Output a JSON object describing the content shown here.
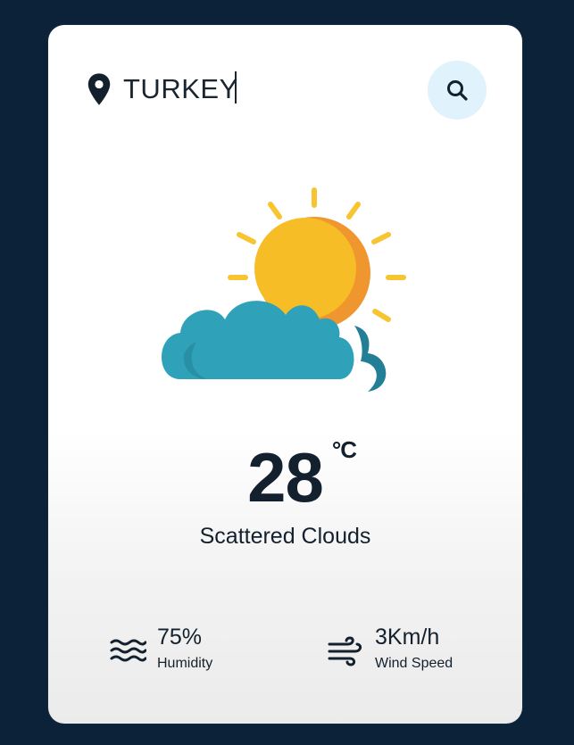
{
  "search": {
    "value": "TURKEY",
    "placeholder": "",
    "icon": "map-pin-icon",
    "button_icon": "search-icon"
  },
  "weather": {
    "icon": "partly-cloudy-sun-icon",
    "temperature": "28",
    "unit": "°C",
    "condition": "Scattered Clouds"
  },
  "details": {
    "humidity": {
      "value": "75%",
      "label": "Humidity",
      "icon": "humidity-waves-icon"
    },
    "wind": {
      "value": "3Km/h",
      "label": "Wind Speed",
      "icon": "wind-icon"
    }
  },
  "colors": {
    "background": "#0b2238",
    "card": "#ffffff",
    "text": "#13202d",
    "search_button": "#e0f2fb",
    "sun": "#f7bd26",
    "sun_shade": "#f0962f",
    "sun_rays": "#f7c531",
    "cloud": "#2fa2b9",
    "cloud_shade": "#227f95"
  }
}
